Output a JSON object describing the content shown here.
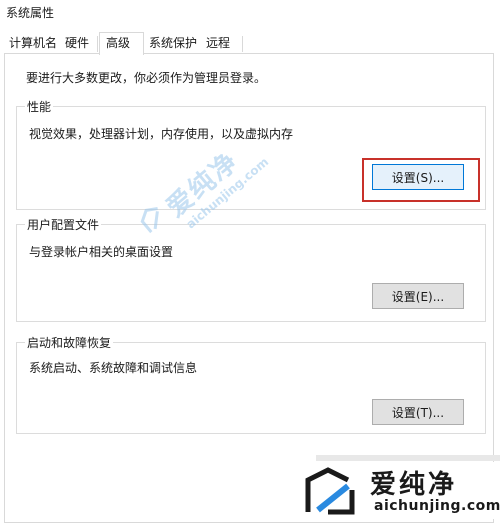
{
  "window": {
    "title": "系统属性"
  },
  "tabs": [
    {
      "label": "计算机名",
      "active": false
    },
    {
      "label": "硬件",
      "active": false
    },
    {
      "label": "高级",
      "active": true
    },
    {
      "label": "系统保护",
      "active": false
    },
    {
      "label": "远程",
      "active": false
    }
  ],
  "admin_note": "要进行大多数更改，你必须作为管理员登录。",
  "performance": {
    "title": "性能",
    "description": "视觉效果，处理器计划，内存使用，以及虚拟内存",
    "button_label": "设置(S)..."
  },
  "user_profiles": {
    "title": "用户配置文件",
    "description": "与登录帐户相关的桌面设置",
    "button_label": "设置(E)..."
  },
  "startup_recovery": {
    "title": "启动和故障恢复",
    "description": "系统启动、系统故障和调试信息",
    "button_label": "设置(T)..."
  },
  "watermark": {
    "main": "爱纯净",
    "sub": "aichunjing.com"
  },
  "brand": {
    "name_cn": "爱纯净",
    "name_en": "aichunjing.com"
  },
  "colors": {
    "highlight_border": "#c8312a",
    "focus_blue": "#0078d7",
    "button_face": "#e1e1e1",
    "watermark_blue": "#9cc8ec"
  },
  "icons": [
    "brand-logo-icon",
    "watermark-logo-icon"
  ]
}
